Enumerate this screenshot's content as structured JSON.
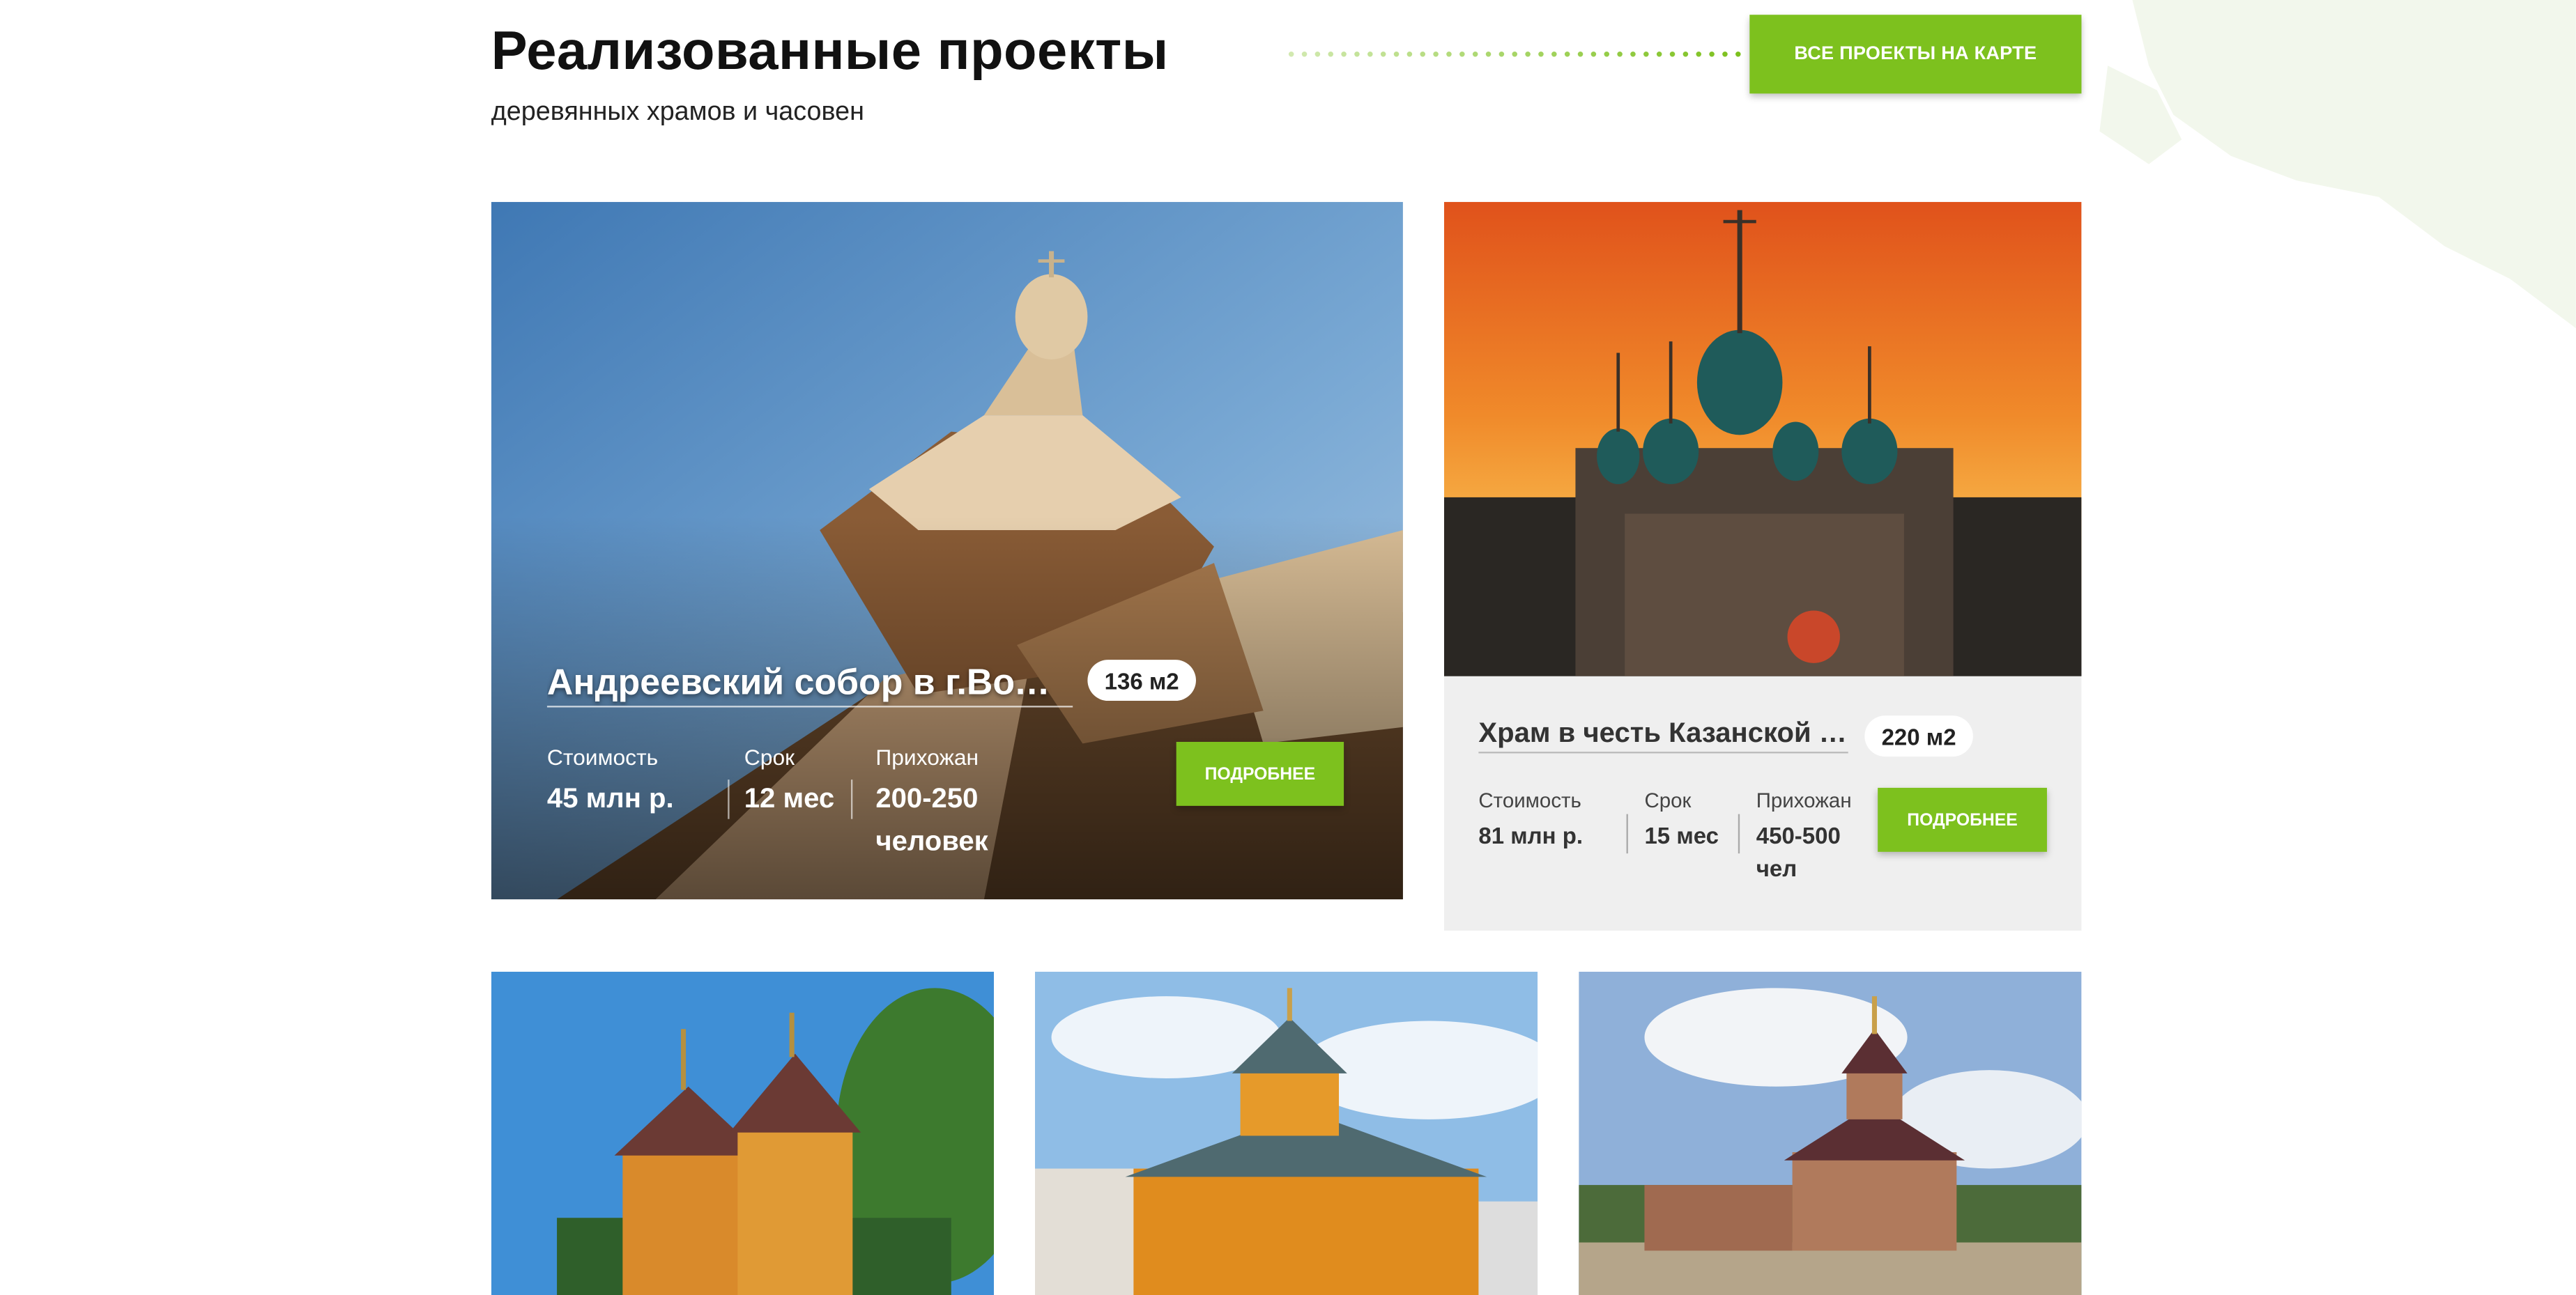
{
  "header": {
    "title": "Реализованные проекты",
    "subtitle": "деревянных храмов и часовен",
    "map_button": "ВСЕ ПРОЕКТЫ НА КАРТЕ"
  },
  "colors": {
    "accent": "#7dc11e",
    "card_bg": "#efefef"
  },
  "projects": [
    {
      "title": "Андреевский собор в г.Волх...",
      "area": "136 м2",
      "cost_label": "Стоимость",
      "cost": "45 млн р.",
      "term_label": "Срок",
      "term": "12 мес",
      "parish_label": "Прихожан",
      "parish": "200-250 человек",
      "more": "ПОДРОБНЕЕ"
    },
    {
      "title": "Храм в честь Казанской и...",
      "area": "220 м2",
      "cost_label": "Стоимость",
      "cost": "81 млн р.",
      "term_label": "Срок",
      "term": "15 мес",
      "parish_label": "Прихожан",
      "parish": "450-500 чел",
      "more": "ПОДРОБНЕЕ"
    }
  ]
}
